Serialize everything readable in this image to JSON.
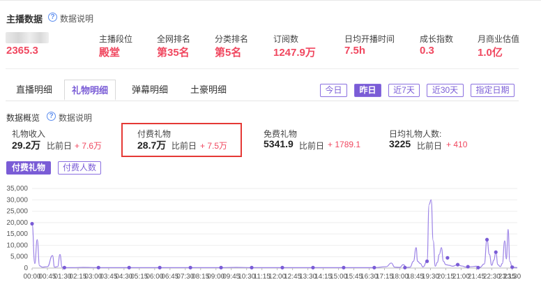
{
  "header": {
    "title": "主播数据",
    "help": "数据说明"
  },
  "anchor": {
    "main_value": "2365.3"
  },
  "stats": [
    {
      "label": "主播段位",
      "value": "殿堂"
    },
    {
      "label": "全网排名",
      "value": "第35名"
    },
    {
      "label": "分类排名",
      "value": "第5名"
    },
    {
      "label": "订阅数",
      "value": "1247.9万"
    },
    {
      "label": "日均开播时间",
      "value": "7.5h"
    },
    {
      "label": "成长指数",
      "value": "0.3"
    },
    {
      "label": "月商业估值",
      "value": "1.0亿"
    }
  ],
  "tabs": [
    {
      "label": "直播明细",
      "active": false
    },
    {
      "label": "礼物明细",
      "active": true
    },
    {
      "label": "弹幕明细",
      "active": false
    },
    {
      "label": "土豪明细",
      "active": false
    }
  ],
  "date_filters": [
    {
      "label": "今日",
      "active": false
    },
    {
      "label": "昨日",
      "active": true
    },
    {
      "label": "近7天",
      "active": false
    },
    {
      "label": "近30天",
      "active": false
    },
    {
      "label": "指定日期",
      "active": false
    }
  ],
  "overview": {
    "title": "数据概览",
    "help": "数据说明",
    "metrics": [
      {
        "label": "礼物收入",
        "value": "29.2万",
        "compare_label": "比前日",
        "delta": "+ 7.6万"
      },
      {
        "label": "付费礼物",
        "value": "28.7万",
        "compare_label": "比前日",
        "delta": "+ 7.5万"
      },
      {
        "label": "免费礼物",
        "value": "5341.9",
        "compare_label": "比前日",
        "delta": "+ 1789.1"
      },
      {
        "label": "日均礼物人数:",
        "value": "3225",
        "compare_label": "比前日",
        "delta": "+ 410"
      }
    ]
  },
  "chart_toggles": [
    {
      "label": "付费礼物",
      "active": true
    },
    {
      "label": "付费人数",
      "active": false
    }
  ],
  "colors": {
    "accent": "#7a5cd6",
    "value_red": "#f0475f",
    "highlight_border": "#e53935"
  },
  "chart_data": {
    "type": "line",
    "yticks": [
      0,
      5000,
      10000,
      15000,
      20000,
      25000,
      30000,
      35000
    ],
    "ytick_labels": [
      "0",
      "5,000",
      "10,000",
      "15,000",
      "20,000",
      "25,000",
      "30,000",
      "35,000"
    ],
    "ylim": [
      0,
      35000
    ],
    "xlim": [
      0,
      1425
    ],
    "xtick_labels": [
      "00:00",
      "00:45",
      "01:30",
      "02:15",
      "03:00",
      "03:45",
      "04:30",
      "05:15",
      "06:00",
      "06:45",
      "07:30",
      "08:15",
      "09:00",
      "09:45",
      "10:30",
      "11:15",
      "12:00",
      "12:45",
      "13:30",
      "14:15",
      "15:00",
      "15:45",
      "16:30",
      "17:15",
      "18:00",
      "18:45",
      "19:30",
      "20:15",
      "21:00",
      "21:45",
      "22:30",
      "23:15",
      "23:30"
    ],
    "xtick_minutes": [
      0,
      45,
      90,
      135,
      180,
      225,
      270,
      315,
      360,
      405,
      450,
      495,
      540,
      585,
      630,
      675,
      720,
      765,
      810,
      855,
      900,
      945,
      990,
      1035,
      1080,
      1125,
      1170,
      1215,
      1260,
      1305,
      1350,
      1395,
      1410
    ],
    "grid": true,
    "series": [
      {
        "values": [
          [
            0,
            19500
          ],
          [
            8,
            2000
          ],
          [
            15,
            12500
          ],
          [
            22,
            1000
          ],
          [
            30,
            400
          ],
          [
            45,
            600
          ],
          [
            60,
            5500
          ],
          [
            66,
            400
          ],
          [
            75,
            600
          ],
          [
            82,
            6000
          ],
          [
            88,
            400
          ],
          [
            95,
            200
          ],
          [
            120,
            200
          ],
          [
            150,
            300
          ],
          [
            195,
            200
          ],
          [
            240,
            200
          ],
          [
            285,
            200
          ],
          [
            330,
            200
          ],
          [
            375,
            200
          ],
          [
            420,
            200
          ],
          [
            465,
            200
          ],
          [
            510,
            200
          ],
          [
            555,
            200
          ],
          [
            600,
            300
          ],
          [
            645,
            200
          ],
          [
            690,
            200
          ],
          [
            735,
            200
          ],
          [
            780,
            200
          ],
          [
            825,
            200
          ],
          [
            870,
            200
          ],
          [
            915,
            200
          ],
          [
            960,
            200
          ],
          [
            1005,
            200
          ],
          [
            1040,
            600
          ],
          [
            1055,
            2200
          ],
          [
            1065,
            400
          ],
          [
            1080,
            300
          ],
          [
            1090,
            1500
          ],
          [
            1100,
            300
          ],
          [
            1110,
            400
          ],
          [
            1120,
            3000
          ],
          [
            1128,
            9000
          ],
          [
            1132,
            3000
          ],
          [
            1140,
            2000
          ],
          [
            1148,
            500
          ],
          [
            1160,
            3000
          ],
          [
            1166,
            28000
          ],
          [
            1172,
            30000
          ],
          [
            1178,
            12000
          ],
          [
            1184,
            800
          ],
          [
            1190,
            2500
          ],
          [
            1196,
            6000
          ],
          [
            1202,
            9000
          ],
          [
            1208,
            3000
          ],
          [
            1215,
            1500
          ],
          [
            1225,
            1200
          ],
          [
            1235,
            800
          ],
          [
            1250,
            1500
          ],
          [
            1262,
            900
          ],
          [
            1275,
            400
          ],
          [
            1290,
            600
          ],
          [
            1305,
            800
          ],
          [
            1315,
            300
          ],
          [
            1328,
            1800
          ],
          [
            1336,
            12500
          ],
          [
            1343,
            6000
          ],
          [
            1350,
            1200
          ],
          [
            1356,
            3500
          ],
          [
            1362,
            7000
          ],
          [
            1368,
            1500
          ],
          [
            1375,
            600
          ],
          [
            1381,
            2000
          ],
          [
            1388,
            12000
          ],
          [
            1393,
            4000
          ],
          [
            1398,
            17000
          ],
          [
            1403,
            3000
          ],
          [
            1410,
            400
          ],
          [
            1425,
            200
          ]
        ]
      }
    ],
    "markers": [
      [
        0,
        19500
      ],
      [
        95,
        200
      ],
      [
        195,
        200
      ],
      [
        285,
        200
      ],
      [
        375,
        200
      ],
      [
        465,
        200
      ],
      [
        555,
        200
      ],
      [
        645,
        200
      ],
      [
        735,
        200
      ],
      [
        825,
        200
      ],
      [
        915,
        200
      ],
      [
        1005,
        200
      ],
      [
        1095,
        200
      ],
      [
        1160,
        3000
      ],
      [
        1220,
        4500
      ],
      [
        1250,
        1500
      ],
      [
        1280,
        600
      ],
      [
        1310,
        200
      ],
      [
        1336,
        12500
      ],
      [
        1362,
        7000
      ],
      [
        1410,
        400
      ]
    ]
  }
}
